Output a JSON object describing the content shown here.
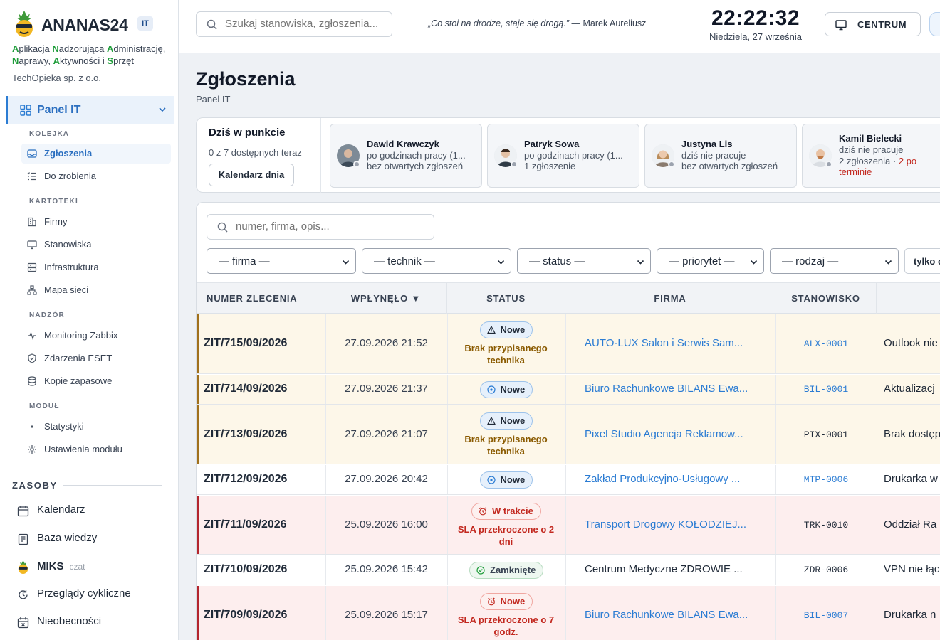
{
  "brand": {
    "name": "ANANAS24",
    "badge": "IT",
    "tagline_words": [
      {
        "cap": "A",
        "rest": "plikacja "
      },
      {
        "cap": "N",
        "rest": "adzorująca "
      },
      {
        "cap": "A",
        "rest": "dministrację, "
      },
      {
        "cap": "N",
        "rest": "aprawy, "
      },
      {
        "cap": "A",
        "rest": "ktywności i "
      },
      {
        "cap": "S",
        "rest": "przęt"
      }
    ],
    "company": "TechOpieka sp. z o.o.",
    "colors": {
      "accent": "#2b7cd3",
      "green": "#1f9d3a"
    }
  },
  "sidebar": {
    "panel": "Panel IT",
    "sections": {
      "kolejka": "KOLEJKA",
      "kartoteki": "KARTOTEKI",
      "nadzor": "NADZÓR",
      "modul": "MODUŁ"
    },
    "items": {
      "zgloszenia": "Zgłoszenia",
      "do_zrobienia": "Do zrobienia",
      "firmy": "Firmy",
      "stanowiska": "Stanowiska",
      "infrastruktura": "Infrastruktura",
      "mapa_sieci": "Mapa sieci",
      "monitoring": "Monitoring Zabbix",
      "eset": "Zdarzenia ESET",
      "kopie": "Kopie zapasowe",
      "statystyki": "Statystyki",
      "ustawienia": "Ustawienia modułu"
    },
    "resources_title": "ZASOBY",
    "resources": {
      "kalendarz": "Kalendarz",
      "baza": "Baza wiedzy",
      "miks": "MIKS",
      "miks_sub": "czat",
      "przeglady": "Przeglądy cykliczne",
      "nieobecnosci": "Nieobecności"
    }
  },
  "topbar": {
    "search_placeholder": "Szukaj stanowiska, zgłoszenia...",
    "quote_text": "„Co stoi na drodze, staje się drogą.”",
    "quote_author": " — Marek Aureliusz",
    "time": "22:22:32",
    "date": "Niedziela, 27 września",
    "centrum": "CENTRUM"
  },
  "page": {
    "title": "Zgłoszenia",
    "subtitle": "Panel IT"
  },
  "today": {
    "title": "Dziś w punkcie",
    "available": "0 z 7 dostępnych teraz",
    "calendar_button": "Kalendarz dnia",
    "technicians": [
      {
        "name": "Dawid Krawczyk",
        "line1": "po godzinach pracy (1...",
        "line2": "bez otwartych zgłoszeń",
        "late": ""
      },
      {
        "name": "Patryk Sowa",
        "line1": "po godzinach pracy (1...",
        "line2": "1 zgłoszenie",
        "late": ""
      },
      {
        "name": "Justyna Lis",
        "line1": "dziś nie pracuje",
        "line2": "bez otwartych zgłoszeń",
        "late": ""
      },
      {
        "name": "Kamil Bielecki",
        "line1": "dziś nie pracuje",
        "line2": "2 zgłoszenia · ",
        "late": "2 po terminie"
      }
    ]
  },
  "tickets": {
    "search_placeholder": "numer, firma, opis...",
    "filters": {
      "firma": "— firma —",
      "technik": "— technik —",
      "status": "— status —",
      "priorytet": "— priorytet —",
      "rodzaj": "— rodzaj —",
      "only": "tylko o"
    },
    "columns": {
      "numer": "NUMER ZLECENIA",
      "wplynelo": "WPŁYNĘŁO ▼",
      "status": "STATUS",
      "firma": "FIRMA",
      "stanowisko": "STANOWISKO"
    },
    "rows": [
      {
        "num": "ZIT/715/09/2026",
        "date": "27.09.2026 21:52",
        "status": "Nowe",
        "note_l1": "Brak przypisanego",
        "note_l2": "technika",
        "firm": "AUTO-LUX Salon i Serwis Sam...",
        "stn": "ALX-0001",
        "desc": "Outlook nie"
      },
      {
        "num": "ZIT/714/09/2026",
        "date": "27.09.2026 21:37",
        "status": "Nowe",
        "note_l1": "",
        "note_l2": "",
        "firm": "Biuro Rachunkowe BILANS Ewa...",
        "stn": "BIL-0001",
        "desc": "Aktualizacj"
      },
      {
        "num": "ZIT/713/09/2026",
        "date": "27.09.2026 21:07",
        "status": "Nowe",
        "note_l1": "Brak przypisanego",
        "note_l2": "technika",
        "firm": "Pixel Studio Agencja Reklamow...",
        "stn": "PIX-0001",
        "desc": "Brak dostęp"
      },
      {
        "num": "ZIT/712/09/2026",
        "date": "27.09.2026 20:42",
        "status": "Nowe",
        "note_l1": "",
        "note_l2": "",
        "firm": "Zakład Produkcyjno-Usługowy ...",
        "stn": "MTP-0006",
        "desc": "Drukarka w"
      },
      {
        "num": "ZIT/711/09/2026",
        "date": "25.09.2026 16:00",
        "status": "W trakcie",
        "note_l1": "SLA przekroczone o 2",
        "note_l2": "dni",
        "firm": "Transport Drogowy KOŁODZIEJ...",
        "stn": "TRK-0010",
        "desc": "Oddział Ra"
      },
      {
        "num": "ZIT/710/09/2026",
        "date": "25.09.2026 15:42",
        "status": "Zamknięte",
        "note_l1": "",
        "note_l2": "",
        "firm": "Centrum Medyczne ZDROWIE ...",
        "stn": "ZDR-0006",
        "desc": "VPN nie łąc"
      },
      {
        "num": "ZIT/709/09/2026",
        "date": "25.09.2026 15:17",
        "status": "Nowe",
        "note_l1": "SLA przekroczone o 7",
        "note_l2": "godz.",
        "firm": "Biuro Rachunkowe BILANS Ewa...",
        "stn": "BIL-0007",
        "desc": "Drukarka n"
      }
    ]
  }
}
